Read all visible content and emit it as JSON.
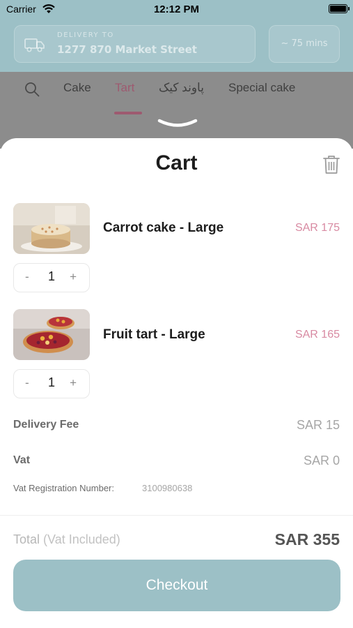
{
  "status_bar": {
    "carrier": "Carrier",
    "time": "12:12 PM"
  },
  "header": {
    "delivery_label": "DELIVERY TO",
    "delivery_address": "1277 870 Market Street",
    "eta": "~ 75 mins"
  },
  "categories": {
    "tabs": [
      {
        "label": "Cake",
        "active": false
      },
      {
        "label": "Tart",
        "active": true
      },
      {
        "label": "پاوند کیک",
        "active": false
      },
      {
        "label": "Special cake",
        "active": false
      }
    ]
  },
  "cart": {
    "title": "Cart",
    "items": [
      {
        "name": "Carrot cake - Large",
        "price": "SAR 175",
        "quantity": "1",
        "minus": "-",
        "plus": "+"
      },
      {
        "name": "Fruit tart - Large",
        "price": "SAR 165",
        "quantity": "1",
        "minus": "-",
        "plus": "+"
      }
    ],
    "delivery_fee_label": "Delivery Fee",
    "delivery_fee_value": "SAR 15",
    "vat_label": "Vat",
    "vat_value": "SAR 0",
    "vat_registration_label": "Vat Registration Number:",
    "vat_registration_number": "3100980638",
    "total_label": "Total",
    "total_sublabel": "(Vat Included)",
    "total_value": "SAR 355",
    "checkout_label": "Checkout"
  },
  "colors": {
    "accent_teal": "#9cc0c6",
    "price_pink": "#d88aa2",
    "active_tab": "#9e5a70"
  },
  "icons": [
    "wifi-icon",
    "battery-icon",
    "truck-icon",
    "search-icon",
    "chevron-down-icon",
    "trash-icon"
  ]
}
